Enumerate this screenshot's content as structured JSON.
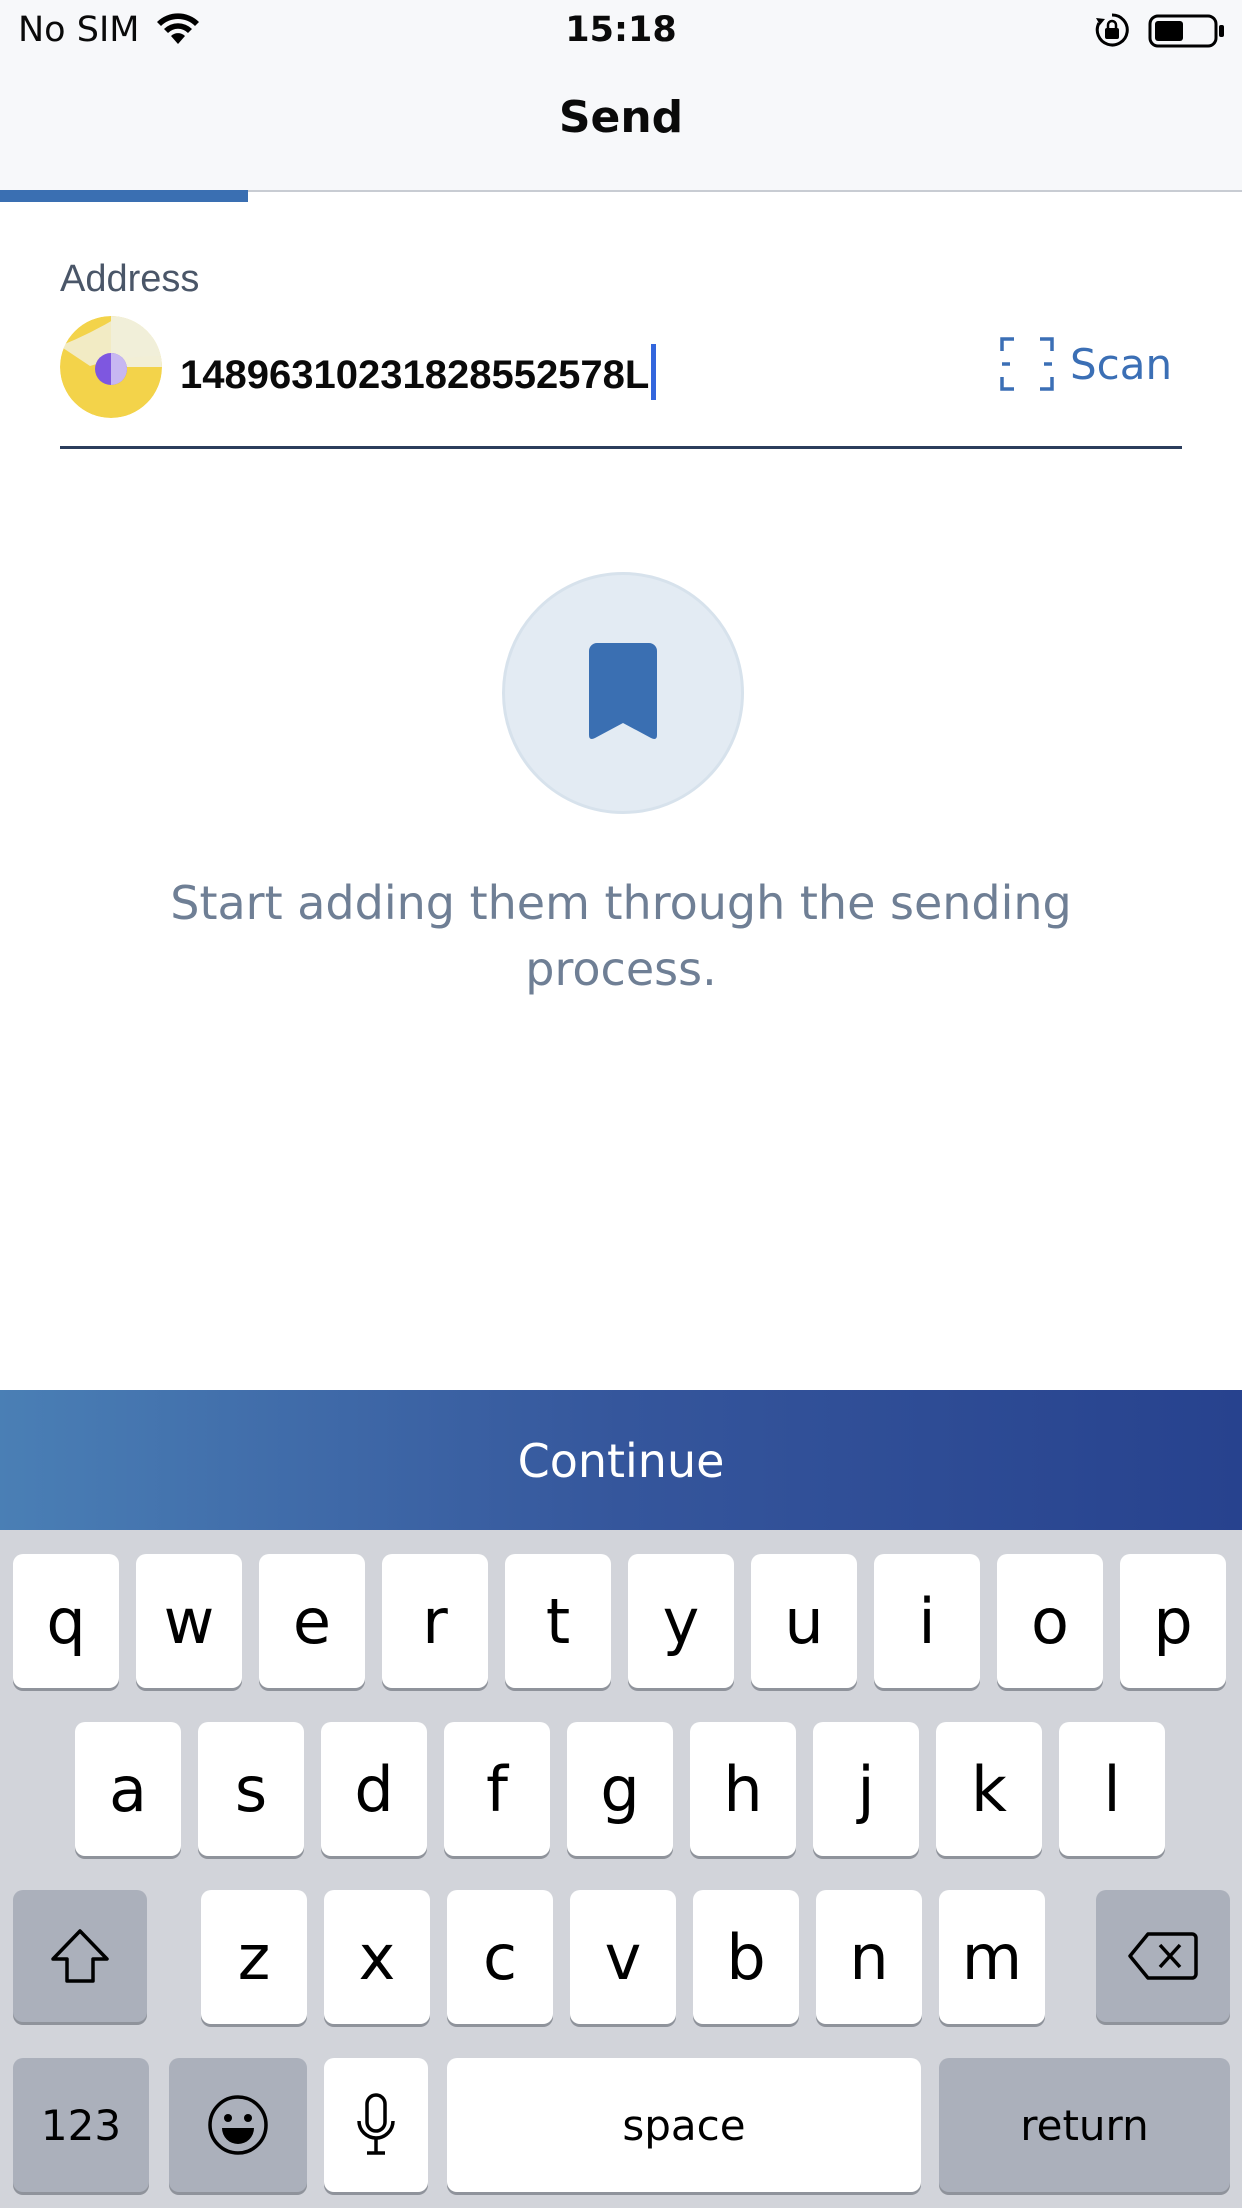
{
  "status_bar": {
    "carrier": "No SIM",
    "time": "15:18"
  },
  "nav": {
    "title": "Send",
    "progress": 0.2
  },
  "address": {
    "label": "Address",
    "value": "14896310231828552578L",
    "scan_label": "Scan"
  },
  "empty_state": {
    "message": "Start adding them through the sending process."
  },
  "continue_label": "Continue",
  "colors": {
    "accent": "#3b6fb5",
    "progress": "#3a6fb2",
    "avatar_yellow": "#f3d34a",
    "avatar_purple": "#7e57e0"
  },
  "keyboard": {
    "row1": [
      "q",
      "w",
      "e",
      "r",
      "t",
      "y",
      "u",
      "i",
      "o",
      "p"
    ],
    "row2": [
      "a",
      "s",
      "d",
      "f",
      "g",
      "h",
      "j",
      "k",
      "l"
    ],
    "row3": [
      "z",
      "x",
      "c",
      "v",
      "b",
      "n",
      "m"
    ],
    "numbers_label": "123",
    "space_label": "space",
    "return_label": "return",
    "icons": [
      "shift-icon",
      "backspace-icon",
      "emoji-icon",
      "microphone-icon"
    ]
  }
}
